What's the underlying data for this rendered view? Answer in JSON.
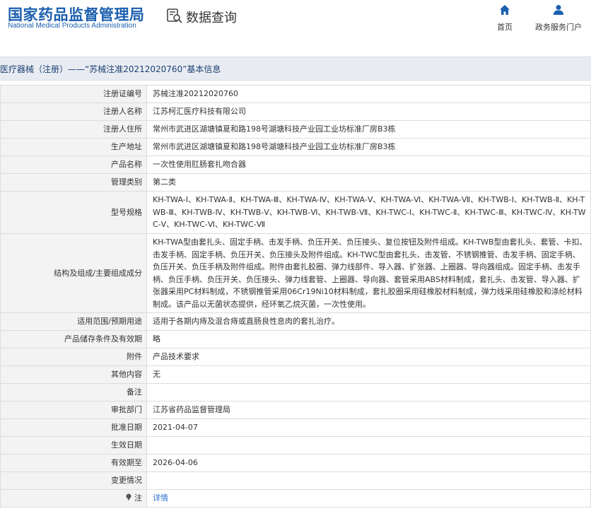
{
  "header": {
    "logo_cn": "国家药品监督管理局",
    "logo_en": "National Medical Products Administration",
    "search_title": "数据查询",
    "nav_home": "首页",
    "nav_services": "政务服务门户"
  },
  "page_title": "医疗器械（注册）——“苏械注准20212020760”基本信息",
  "rows": [
    {
      "label": "注册证编号",
      "value": "苏械注准20212020760"
    },
    {
      "label": "注册人名称",
      "value": "江苏柯汇医疗科技有限公司"
    },
    {
      "label": "注册人住所",
      "value": "常州市武进区湖塘镇夏和路198号湖塘科技产业园工业坊标准厂房B3栋"
    },
    {
      "label": "生产地址",
      "value": "常州市武进区湖塘镇夏和路198号湖塘科技产业园工业坊标准厂房B3栋"
    },
    {
      "label": "产品名称",
      "value": "一次性使用肛肠套扎吻合器"
    },
    {
      "label": "管理类别",
      "value": "第二类"
    },
    {
      "label": "型号规格",
      "value": "KH-TWA-Ⅰ、KH-TWA-Ⅱ、KH-TWA-Ⅲ、KH-TWA-Ⅳ、KH-TWA-Ⅴ、KH-TWA-Ⅵ、KH-TWA-Ⅶ、KH-TWB-Ⅰ、KH-TWB-Ⅱ、KH-TWB-Ⅲ、KH-TWB-Ⅳ、KH-TWB-Ⅴ、KH-TWB-Ⅵ、KH-TWB-Ⅶ、KH-TWC-Ⅰ、KH-TWC-Ⅱ、KH-TWC-Ⅲ、KH-TWC-Ⅳ、KH-TWC-Ⅴ、KH-TWC-Ⅵ、KH-TWC-Ⅶ"
    },
    {
      "label": "结构及组成/主要组成成分",
      "value": "KH-TWA型由套扎头、固定手柄、击发手柄、负压开关、负压接头、复位按钮及附件组成。KH-TWB型由套扎头、套管、卡扣、击发手柄、固定手柄、负压开关、负压接头及附件组成。KH-TWC型由套扎头、击发管、不锈钢推管、击发手柄、固定手柄、负压开关、负压手柄及附件组成。附件由套扎胶圈、弹力线部件、导入器、扩张器、上圈器、导向器组成。固定手柄、击发手柄、负压手柄、负压开关、负压接头、弹力线套管、上圈器、导向器、套管采用ABS材料制成，套扎头、击发管、导入器、扩张器采用PC材料制成，不锈钢推管采用06Cr19Ni10材料制成，套扎胶圈采用硅橡胶材料制成，弹力线采用硅橡胶和涤纶材料制成。该产品以无菌状态提供，经环氧乙烷灭菌，一次性使用。"
    },
    {
      "label": "适用范围/预期用途",
      "value": "适用于各期内痔及混合痔或直肠良性息肉的套扎治疗。"
    },
    {
      "label": "产品储存条件及有效期",
      "value": "略"
    },
    {
      "label": "附件",
      "value": "产品技术要求"
    },
    {
      "label": "其他内容",
      "value": "无"
    },
    {
      "label": "备注",
      "value": ""
    },
    {
      "label": "审批部门",
      "value": "江苏省药品监督管理局"
    },
    {
      "label": "批准日期",
      "value": "2021-04-07"
    },
    {
      "label": "生效日期",
      "value": ""
    },
    {
      "label": "有效期至",
      "value": "2026-04-06"
    },
    {
      "label": "变更情况",
      "value": ""
    }
  ],
  "note_row": {
    "label": "注",
    "link": "详情"
  }
}
